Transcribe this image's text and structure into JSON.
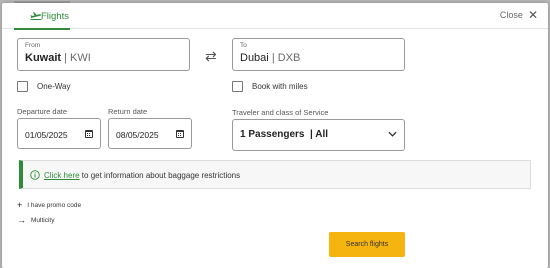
{
  "tabs": [
    {
      "label": "Flights",
      "icon": "airplane-icon",
      "active": true
    }
  ],
  "close": {
    "label": "Close",
    "icon": "close-icon"
  },
  "from": {
    "caption": "From",
    "city": "Kuwait",
    "separator": "|",
    "code": "KWI"
  },
  "to": {
    "caption": "To",
    "city": "Dubai",
    "separator": "|",
    "code": "DXB"
  },
  "swap_icon": "swap-arrows-icon",
  "one_way": {
    "label": "One-Way",
    "checked": false
  },
  "book_with_miles": {
    "label": "Book with miles",
    "checked": false
  },
  "departure": {
    "label": "Departure date",
    "value": "01/05/2025",
    "icon": "calendar-icon"
  },
  "return": {
    "label": "Return date",
    "value": "08/05/2025",
    "icon": "calendar-icon"
  },
  "traveler": {
    "label": "Traveler and class of Service",
    "value": "1 Passengers  | All",
    "icon": "chevron-down-icon"
  },
  "baggage_info": {
    "link_text": "Click here",
    "text": " to get information about baggage restrictions",
    "icon": "info-icon"
  },
  "promo_code": {
    "symbol": "+",
    "label": "I have promo code"
  },
  "multicity": {
    "symbol": "→",
    "label": "Multicity"
  },
  "search_button": {
    "label": "Search flights"
  },
  "colors": {
    "accent": "#2e8b3a",
    "button": "#f5b40f",
    "backdrop": "#b8b8b8"
  }
}
